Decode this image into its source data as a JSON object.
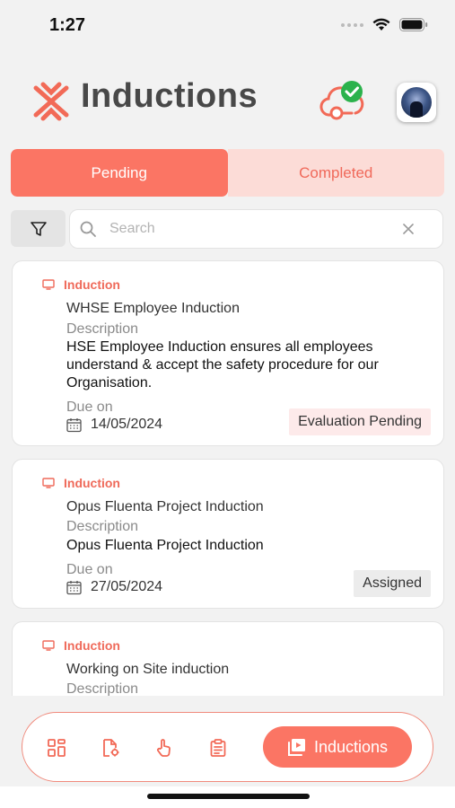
{
  "status_bar": {
    "time": "1:27"
  },
  "header": {
    "title": "Inductions",
    "sync_status": "synced"
  },
  "tabs": [
    {
      "label": "Pending",
      "active": true
    },
    {
      "label": "Completed",
      "active": false
    }
  ],
  "search": {
    "placeholder": "Search",
    "value": ""
  },
  "cards": [
    {
      "type": "Induction",
      "title": "WHSE Employee Induction",
      "description_label": "Description",
      "description": "HSE Employee Induction ensures all employees understand & accept the safety procedure for our Organisation.",
      "due_label": "Due on",
      "due_date": "14/05/2024",
      "status": "Evaluation Pending"
    },
    {
      "type": "Induction",
      "title": "Opus Fluenta Project  Induction",
      "description_label": "Description",
      "description": "Opus Fluenta Project Induction",
      "due_label": "Due on",
      "due_date": "27/05/2024",
      "status": "Assigned"
    },
    {
      "type": "Induction",
      "title": "Working on Site induction",
      "description_label": "Description"
    }
  ],
  "bottom_nav": {
    "items": [
      "dashboard-icon",
      "document-settings-icon",
      "hand-pointer-icon",
      "clipboard-icon"
    ],
    "active_label": "Inductions"
  },
  "colors": {
    "accent": "#fb7564",
    "accent_light": "#fcdcd7",
    "success": "#2bb24c"
  }
}
